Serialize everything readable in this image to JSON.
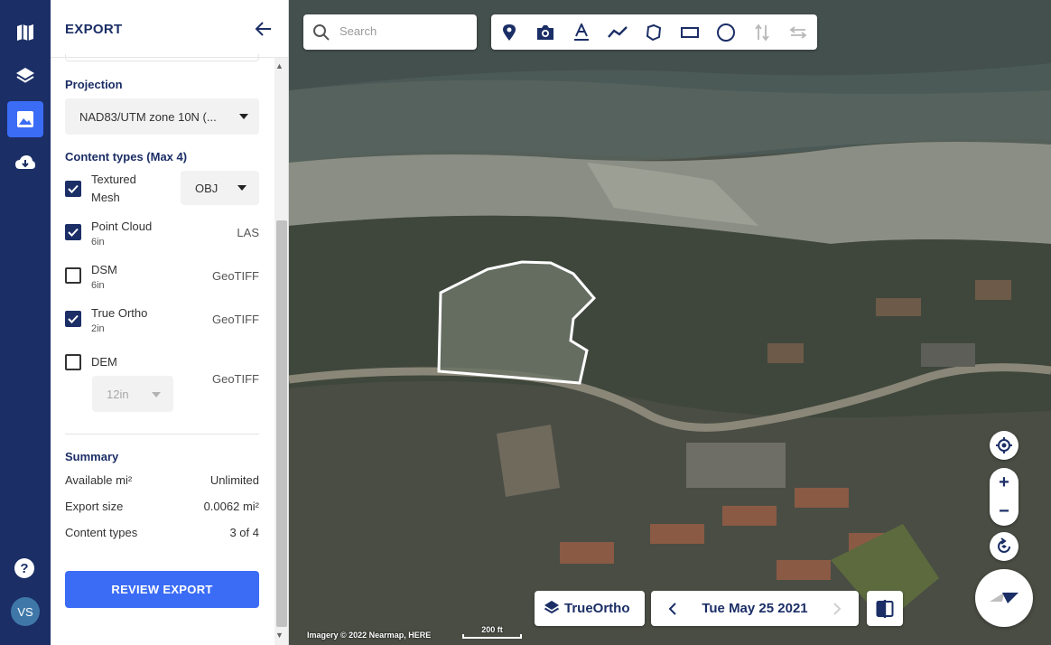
{
  "rail": {
    "help": "?",
    "avatar": "VS",
    "accent": "#3b6cf6",
    "background": "#1b2e66"
  },
  "panel": {
    "title": "EXPORT",
    "projection_label": "Projection",
    "projection_value": "NAD83/UTM zone 10N (...",
    "content_types_label": "Content types (Max 4)",
    "content_types": [
      {
        "name": "Textured Mesh",
        "sub": "",
        "format": "OBJ",
        "checked": true,
        "format_select": true
      },
      {
        "name": "Point Cloud",
        "sub": "6in",
        "format": "LAS",
        "checked": true
      },
      {
        "name": "DSM",
        "sub": "6in",
        "format": "GeoTIFF",
        "checked": false
      },
      {
        "name": "True Ortho",
        "sub": "2in",
        "format": "GeoTIFF",
        "checked": true
      },
      {
        "name": "DEM",
        "sub": "",
        "format": "GeoTIFF",
        "checked": false,
        "resolution": "12in"
      }
    ],
    "summary_label": "Summary",
    "summary": [
      {
        "key": "Available mi²",
        "value": "Unlimited"
      },
      {
        "key": "Export size",
        "value": "0.0062 mi²"
      },
      {
        "key": "Content types",
        "value": "3 of 4"
      }
    ],
    "review_button": "REVIEW EXPORT"
  },
  "map": {
    "search_placeholder": "Search",
    "tools": [
      "pin-icon",
      "camera-icon",
      "text-icon",
      "polyline-icon",
      "polygon-icon",
      "rectangle-icon",
      "circle-icon",
      "sort-icon",
      "swap-icon"
    ],
    "layer_button": "TrueOrtho",
    "date": "Tue May 25 2021",
    "attribution": "Imagery © 2022 Nearmap, HERE",
    "scale_label": "200 ft",
    "zoom_in": "+",
    "zoom_out": "−"
  }
}
